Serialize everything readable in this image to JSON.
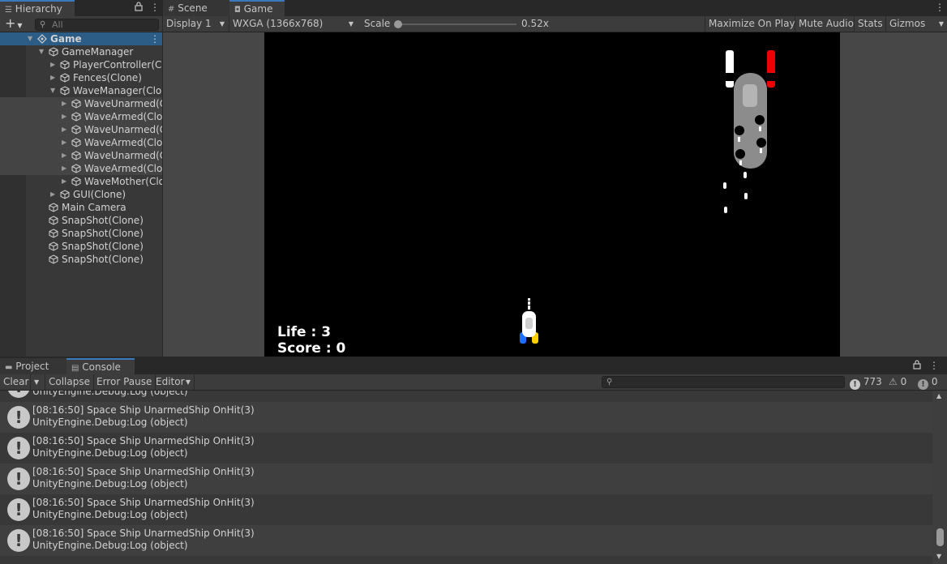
{
  "hierarchy": {
    "tab_label": "Hierarchy",
    "add_label": "+",
    "search_placeholder": "All",
    "items": [
      {
        "label": "Game",
        "depth": 0,
        "expanded": true,
        "bold": true,
        "selected": true
      },
      {
        "label": "GameManager",
        "depth": 1,
        "expanded": true
      },
      {
        "label": "PlayerController(Cl",
        "depth": 2,
        "expanded": false
      },
      {
        "label": "Fences(Clone)",
        "depth": 2,
        "expanded": false
      },
      {
        "label": "WaveManager(Clon",
        "depth": 2,
        "expanded": true
      },
      {
        "label": "WaveUnarmed(C",
        "depth": 3,
        "expanded": false,
        "highlight": true
      },
      {
        "label": "WaveArmed(Clon",
        "depth": 3,
        "expanded": false,
        "highlight": true
      },
      {
        "label": "WaveUnarmed(C",
        "depth": 3,
        "expanded": false,
        "highlight": true
      },
      {
        "label": "WaveArmed(Clon",
        "depth": 3,
        "expanded": false,
        "highlight": true
      },
      {
        "label": "WaveUnarmed(C",
        "depth": 3,
        "expanded": false,
        "highlight": true
      },
      {
        "label": "WaveArmed(Clon",
        "depth": 3,
        "expanded": false,
        "highlight": true
      },
      {
        "label": "WaveMother(Clo",
        "depth": 3,
        "expanded": false
      },
      {
        "label": "GUI(Clone)",
        "depth": 2,
        "expanded": false
      },
      {
        "label": "Main Camera",
        "depth": 1
      },
      {
        "label": "SnapShot(Clone)",
        "depth": 1
      },
      {
        "label": "SnapShot(Clone)",
        "depth": 1
      },
      {
        "label": "SnapShot(Clone)",
        "depth": 1
      },
      {
        "label": "SnapShot(Clone)",
        "depth": 1
      }
    ]
  },
  "gameview": {
    "tabs": [
      {
        "label": "Scene",
        "active": false
      },
      {
        "label": "Game",
        "active": true
      }
    ],
    "display": "Display 1",
    "resolution": "WXGA (1366x768)",
    "scale_label": "Scale",
    "scale_value": "0.52x",
    "maximize": "Maximize On Play",
    "mute": "Mute Audio",
    "stats": "Stats",
    "gizmos": "Gizmos",
    "hud": {
      "life": "Life : 3",
      "score": "Score : 0"
    }
  },
  "console": {
    "tabs": [
      {
        "label": "Project",
        "active": false
      },
      {
        "label": "Console",
        "active": true
      }
    ],
    "clear": "Clear",
    "collapse": "Collapse",
    "error_pause": "Error Pause",
    "editor": "Editor",
    "log_count": "773",
    "warn_count": "0",
    "error_count": "0",
    "partial_entry": "UnityEngine.Debug:Log (object)",
    "entries": [
      {
        "message": "[08:16:50] Space Ship UnarmedShip OnHit(3)",
        "trace": "UnityEngine.Debug:Log (object)"
      },
      {
        "message": "[08:16:50] Space Ship UnarmedShip OnHit(3)",
        "trace": "UnityEngine.Debug:Log (object)"
      },
      {
        "message": "[08:16:50] Space Ship UnarmedShip OnHit(3)",
        "trace": "UnityEngine.Debug:Log (object)"
      },
      {
        "message": "[08:16:50] Space Ship UnarmedShip OnHit(3)",
        "trace": "UnityEngine.Debug:Log (object)"
      },
      {
        "message": "[08:16:50] Space Ship UnarmedShip OnHit(3)",
        "trace": "UnityEngine.Debug:Log (object)"
      }
    ]
  },
  "icons": {
    "hierarchy_tab": "list-icon",
    "lock": "lock-icon",
    "menu": "kebab-menu-icon",
    "search": "search-icon",
    "scene_tab": "grid-icon",
    "game_tab": "gamepad-icon",
    "project_tab": "folder-icon",
    "console_tab": "console-icon",
    "log_entry": "info-icon",
    "warning": "warning-icon",
    "error": "error-icon"
  }
}
